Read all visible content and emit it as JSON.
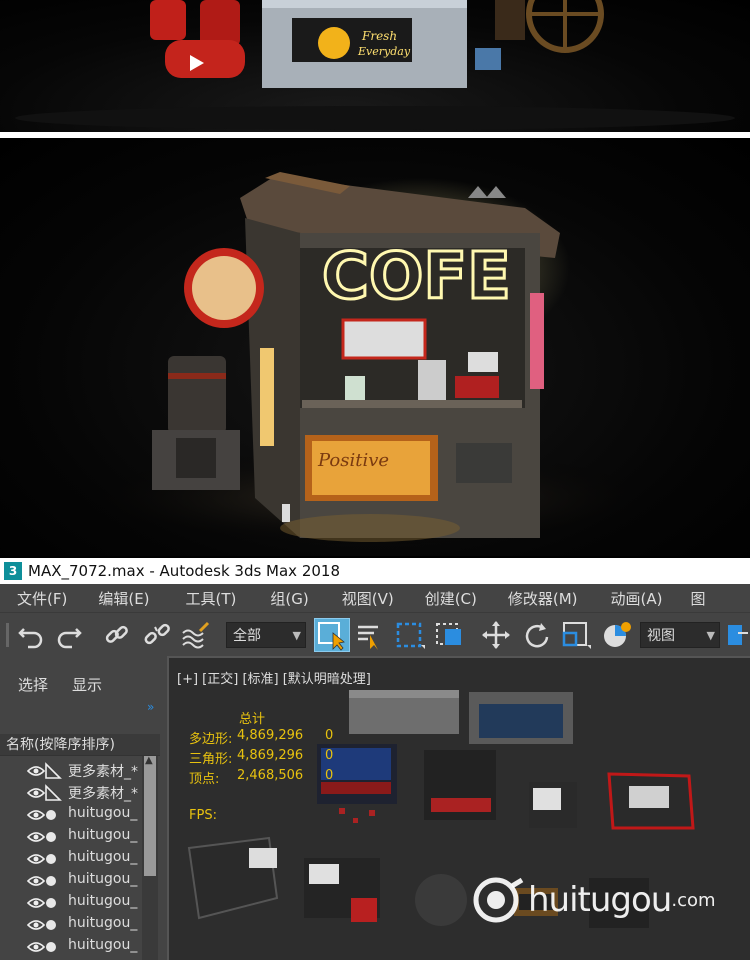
{
  "window": {
    "title": "MAX_7072.max - Autodesk 3ds Max 2018",
    "app_icon": "3"
  },
  "menu": [
    "文件(F)",
    "编辑(E)",
    "工具(T)",
    "组(G)",
    "视图(V)",
    "创建(C)",
    "修改器(M)",
    "动画(A)",
    "图"
  ],
  "toolbar": {
    "selection_filter": "全部",
    "ref_coord": "视图"
  },
  "scene_panel": {
    "tabs": [
      "选择",
      "显示"
    ],
    "column_header": "名称(按降序排序)",
    "items": [
      "更多素材_*",
      "更多素材_*",
      "huitugou_",
      "huitugou_",
      "huitugou_",
      "huitugou_",
      "huitugou_",
      "huitugou_",
      "huitugou_"
    ]
  },
  "viewport": {
    "label": "[+] [正交] [标准] [默认明暗处理]",
    "stats": {
      "header": "总计",
      "rows": [
        {
          "label": "多边形:",
          "total": "4,869,296",
          "selected": "0"
        },
        {
          "label": "三角形:",
          "total": "4,869,296",
          "selected": "0"
        },
        {
          "label": "顶点:",
          "total": "2,468,506",
          "selected": "0"
        }
      ],
      "fps_label": "FPS:"
    }
  },
  "render_main": {
    "neon_text": "COFE"
  },
  "watermark": {
    "brand": "huitugou",
    "domain": ".com"
  },
  "colors": {
    "stats_yellow": "#e8c20f",
    "ui_bg": "#444444",
    "viewport_bg": "#2d2d2d",
    "accent_blue": "#2b8de0"
  }
}
